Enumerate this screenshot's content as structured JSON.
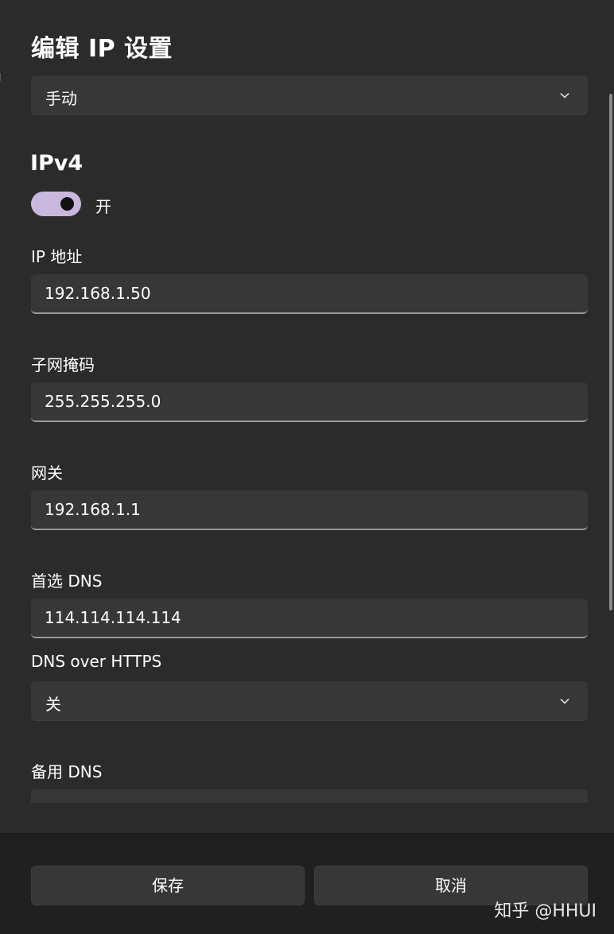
{
  "dialog": {
    "title": "编辑 IP 设置",
    "mode_select": {
      "value": "手动"
    }
  },
  "ipv4": {
    "section_title": "IPv4",
    "toggle": {
      "state": "on",
      "label": "开"
    },
    "ip_address": {
      "label": "IP 地址",
      "value": "192.168.1.50"
    },
    "subnet_mask": {
      "label": "子网掩码",
      "value": "255.255.255.0"
    },
    "gateway": {
      "label": "网关",
      "value": "192.168.1.1"
    },
    "preferred_dns": {
      "label": "首选 DNS",
      "value": "114.114.114.114"
    },
    "dns_over_https": {
      "label": "DNS over HTTPS",
      "value": "关"
    },
    "alternate_dns": {
      "label": "备用 DNS",
      "value": ""
    }
  },
  "footer": {
    "save_label": "保存",
    "cancel_label": "取消"
  },
  "watermark": "知乎 @HHUI",
  "colors": {
    "dialog_bg": "#2b2b2b",
    "control_bg": "#373737",
    "toggle_on": "#c9b8de",
    "footer_bg": "#202020"
  },
  "icons": {
    "dropdown": "chevron-down-icon"
  }
}
